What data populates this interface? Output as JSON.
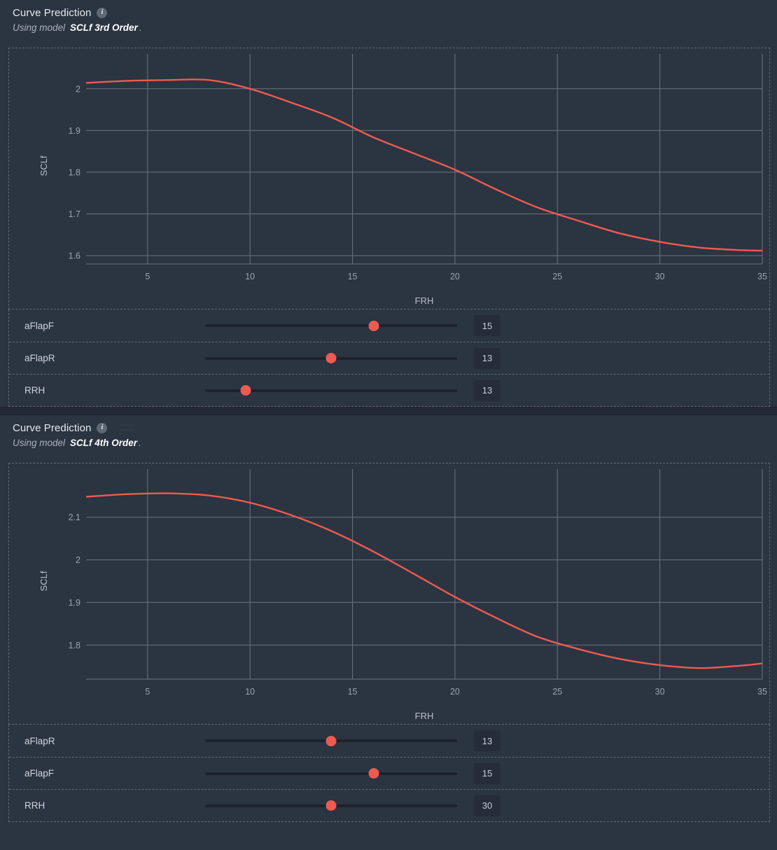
{
  "panels": [
    {
      "title": "Curve Prediction",
      "info_icon": "info-icon",
      "subtitle_lead": "Using model",
      "subtitle_model": "SCLf 3rd Order",
      "subtitle_dot": ".",
      "sliders": [
        {
          "label": "aFlapF",
          "value": "15",
          "pct": 67
        },
        {
          "label": "aFlapR",
          "value": "13",
          "pct": 50
        },
        {
          "label": "RRH",
          "value": "13",
          "pct": 16
        }
      ],
      "chart_data": {
        "type": "line",
        "title": "",
        "xlabel": "FRH",
        "ylabel": "SCLf",
        "xticks": [
          5,
          10,
          15,
          20,
          25,
          30,
          35
        ],
        "yticks": [
          1.6,
          1.7,
          1.8,
          1.9,
          2
        ],
        "xlim": [
          2,
          35
        ],
        "ylim": [
          1.58,
          2.05
        ],
        "grid": true,
        "legend": "none",
        "series": [
          {
            "name": "SCLf 3rd Order",
            "color": "#ef5a50",
            "x": [
              2,
              4,
              6,
              8,
              10,
              12,
              14,
              16,
              18,
              20,
              22,
              24,
              26,
              28,
              30,
              32,
              34,
              35
            ],
            "y": [
              2.014,
              2.019,
              2.021,
              2.021,
              2.0,
              1.967,
              1.931,
              1.884,
              1.845,
              1.806,
              1.759,
              1.716,
              1.684,
              1.654,
              1.633,
              1.619,
              1.613,
              1.612
            ]
          }
        ]
      }
    },
    {
      "title": "Curve Prediction",
      "info_icon": "info-icon",
      "subtitle_lead": "Using model",
      "subtitle_model": "SCLf 4th Order",
      "subtitle_dot": ".",
      "sliders": [
        {
          "label": "aFlapR",
          "value": "13",
          "pct": 50
        },
        {
          "label": "aFlapF",
          "value": "15",
          "pct": 67
        },
        {
          "label": "RRH",
          "value": "30",
          "pct": 50
        }
      ],
      "chart_data": {
        "type": "line",
        "title": "",
        "xlabel": "FRH",
        "ylabel": "SCLf",
        "xticks": [
          5,
          10,
          15,
          20,
          25,
          30,
          35
        ],
        "yticks": [
          1.8,
          1.9,
          2,
          2.1
        ],
        "xlim": [
          2,
          35
        ],
        "ylim": [
          1.72,
          2.18
        ],
        "grid": true,
        "legend": "none",
        "series": [
          {
            "name": "SCLf 4th Order",
            "color": "#ef5a50",
            "x": [
              2,
              4,
              6,
              8,
              10,
              12,
              14,
              16,
              18,
              20,
              22,
              24,
              26,
              28,
              30,
              32,
              34,
              35
            ],
            "y": [
              2.148,
              2.154,
              2.156,
              2.151,
              2.134,
              2.105,
              2.067,
              2.02,
              1.967,
              1.913,
              1.864,
              1.82,
              1.791,
              1.768,
              1.753,
              1.746,
              1.752,
              1.757
            ]
          }
        ]
      }
    }
  ]
}
